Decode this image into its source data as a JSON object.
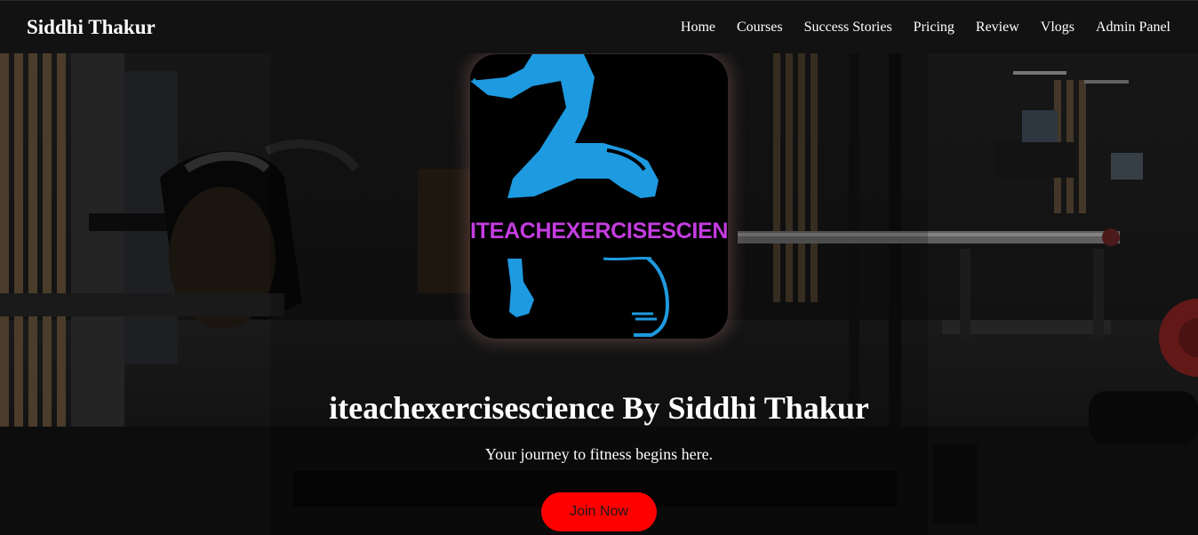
{
  "navbar": {
    "brand": "Siddhi Thakur",
    "links": [
      "Home",
      "Courses",
      "Success Stories",
      "Pricing",
      "Review",
      "Vlogs",
      "Admin Panel"
    ]
  },
  "hero": {
    "logo": {
      "text": "ITEACHEXERCISESCIENCE",
      "text_color": "#c43de0",
      "figure_color": "#1e9ae0"
    },
    "title": "iteachexercisescience By Siddhi Thakur",
    "subtitle": "Your journey to fitness begins here.",
    "cta_label": "Join Now",
    "cta_color": "#ff0000"
  }
}
